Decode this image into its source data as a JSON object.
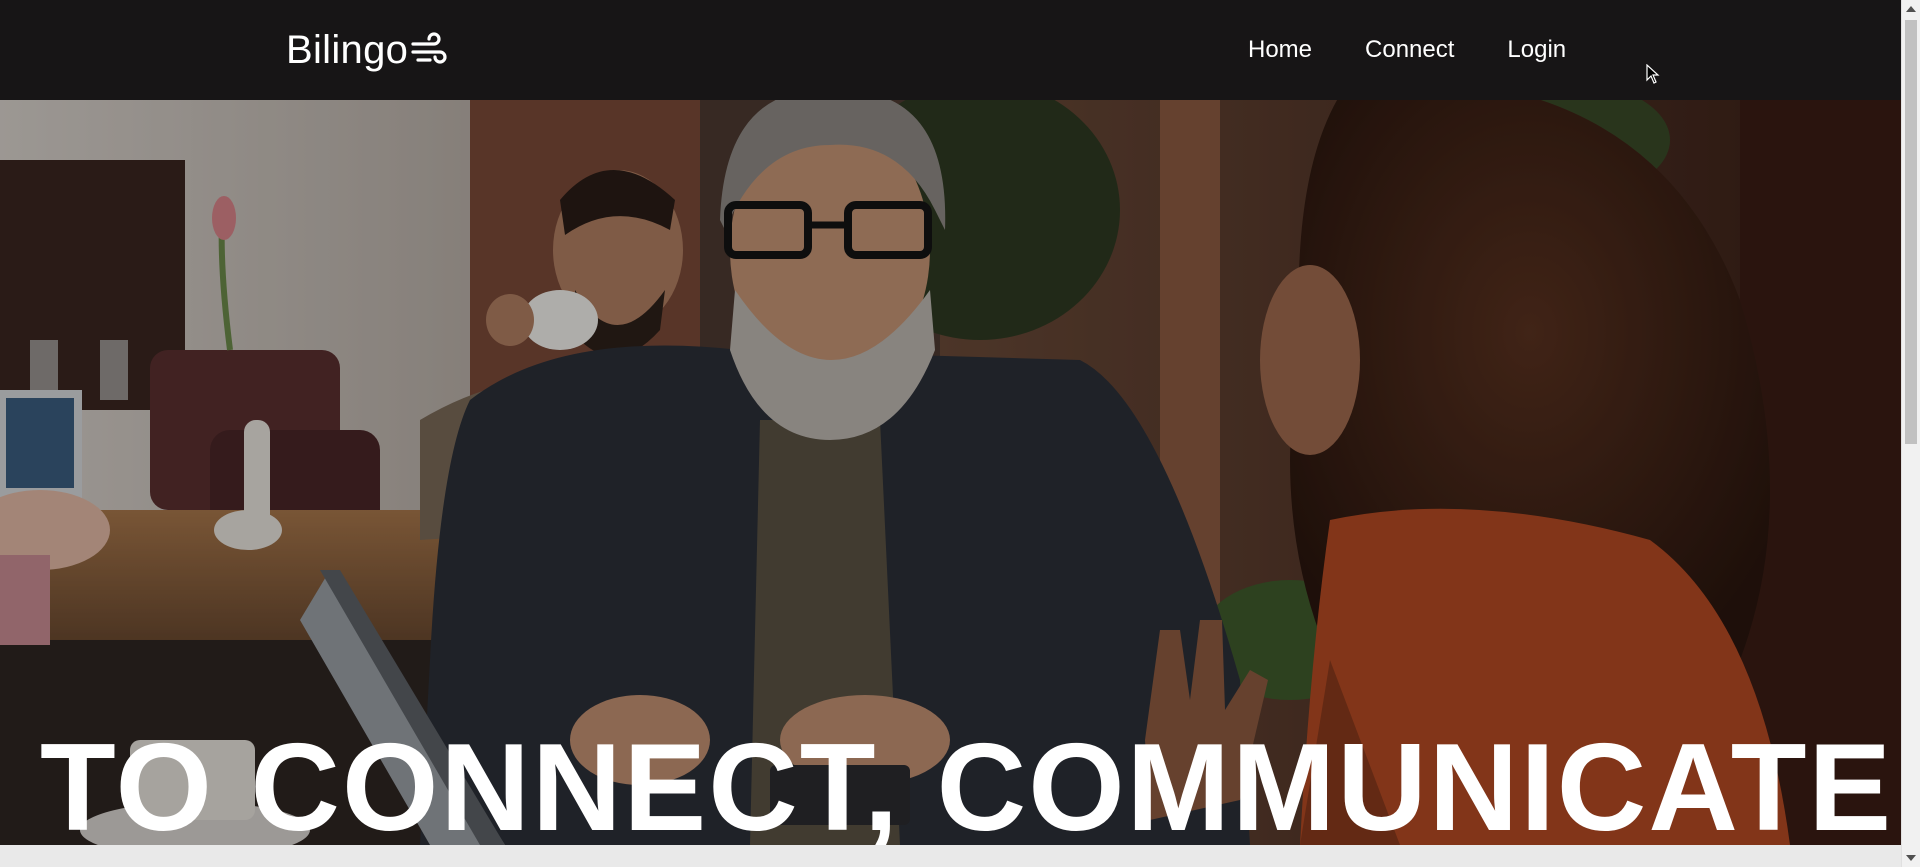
{
  "brand": {
    "name": "Bilingo",
    "icon": "wind-icon"
  },
  "nav": {
    "items": [
      {
        "label": "Home",
        "name": "nav-link-home"
      },
      {
        "label": "Connect",
        "name": "nav-link-connect"
      },
      {
        "label": "Login",
        "name": "nav-link-login"
      }
    ]
  },
  "hero": {
    "headline": "TO CONNECT, COMMUNICATE"
  },
  "colors": {
    "navbar_bg": "#171516",
    "text": "#ffffff",
    "page_bg": "#e9e9e9"
  }
}
